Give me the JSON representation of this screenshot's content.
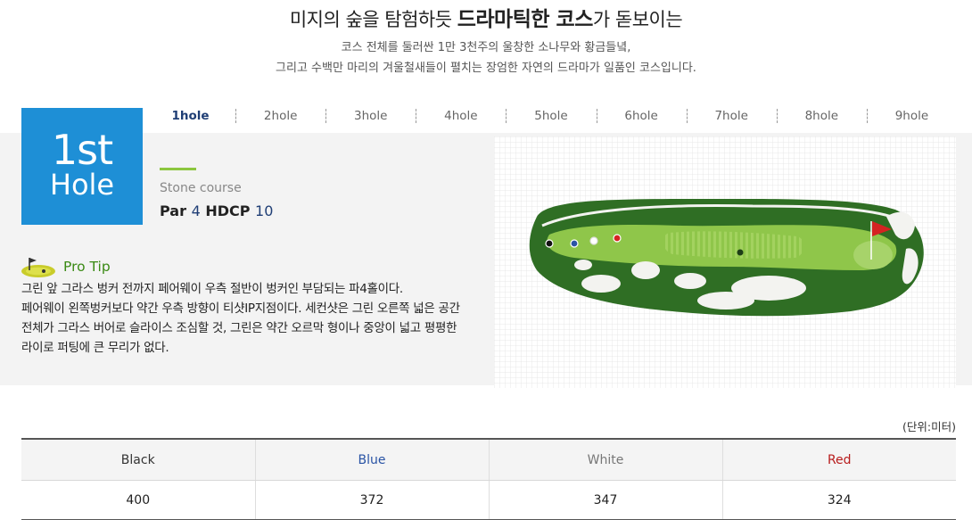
{
  "header": {
    "headline_pre": "미지의 숲을 탐험하듯 ",
    "headline_bold": "드라마틱한 코스",
    "headline_post": "가 돋보이는",
    "desc_line1": "코스 전체를 둘러싼 1만 3천주의 울창한 소나무와 황금들녘,",
    "desc_line2": "그리고 수백만 마리의 겨울철새들이 펼치는 장엄한 자연의 드라마가 일품인 코스입니다."
  },
  "tabs": {
    "active_index": 0,
    "items": [
      "1hole",
      "2hole",
      "3hole",
      "4hole",
      "5hole",
      "6hole",
      "7hole",
      "8hole",
      "9hole"
    ]
  },
  "hole": {
    "badge_number": "1st",
    "badge_word": "Hole",
    "course": "Stone course",
    "par_label": "Par",
    "par_value": "4",
    "hdcp_label": "HDCP",
    "hdcp_value": "10"
  },
  "tip": {
    "icon": "golf-flag-icon",
    "title": "Pro Tip",
    "lines": [
      "그린 앞 그라스 벙커 전까지 페어웨이 우측 절반이 벙커인 부담되는 파4홀이다.",
      "페어웨이 왼쪽벙커보다 약간 우측 방향이 티샷IP지점이다. 세컨샷은 그린 오른쪽 넓은 공간",
      "전체가 그라스 버어로 슬라이스 조심할 것, 그린은 약간 오르막 형이나 중앙이 넓고 평평한",
      "라이로 퍼팅에 큰 무리가 없다."
    ]
  },
  "map": {
    "icon": "hole-layout-map",
    "colors": {
      "rough": "#2f6e24",
      "fairway": "#8fc64a",
      "green": "#a7d36a",
      "bunker": "#f3f3f0",
      "flag": "#d52322"
    }
  },
  "yardage": {
    "unit": "(단위:미터)",
    "headers": [
      "Black",
      "Blue",
      "White",
      "Red"
    ],
    "header_colors": [
      "#333333",
      "#2a54a5",
      "#777777",
      "#b81c1c"
    ],
    "values": [
      "400",
      "372",
      "347",
      "324"
    ]
  }
}
